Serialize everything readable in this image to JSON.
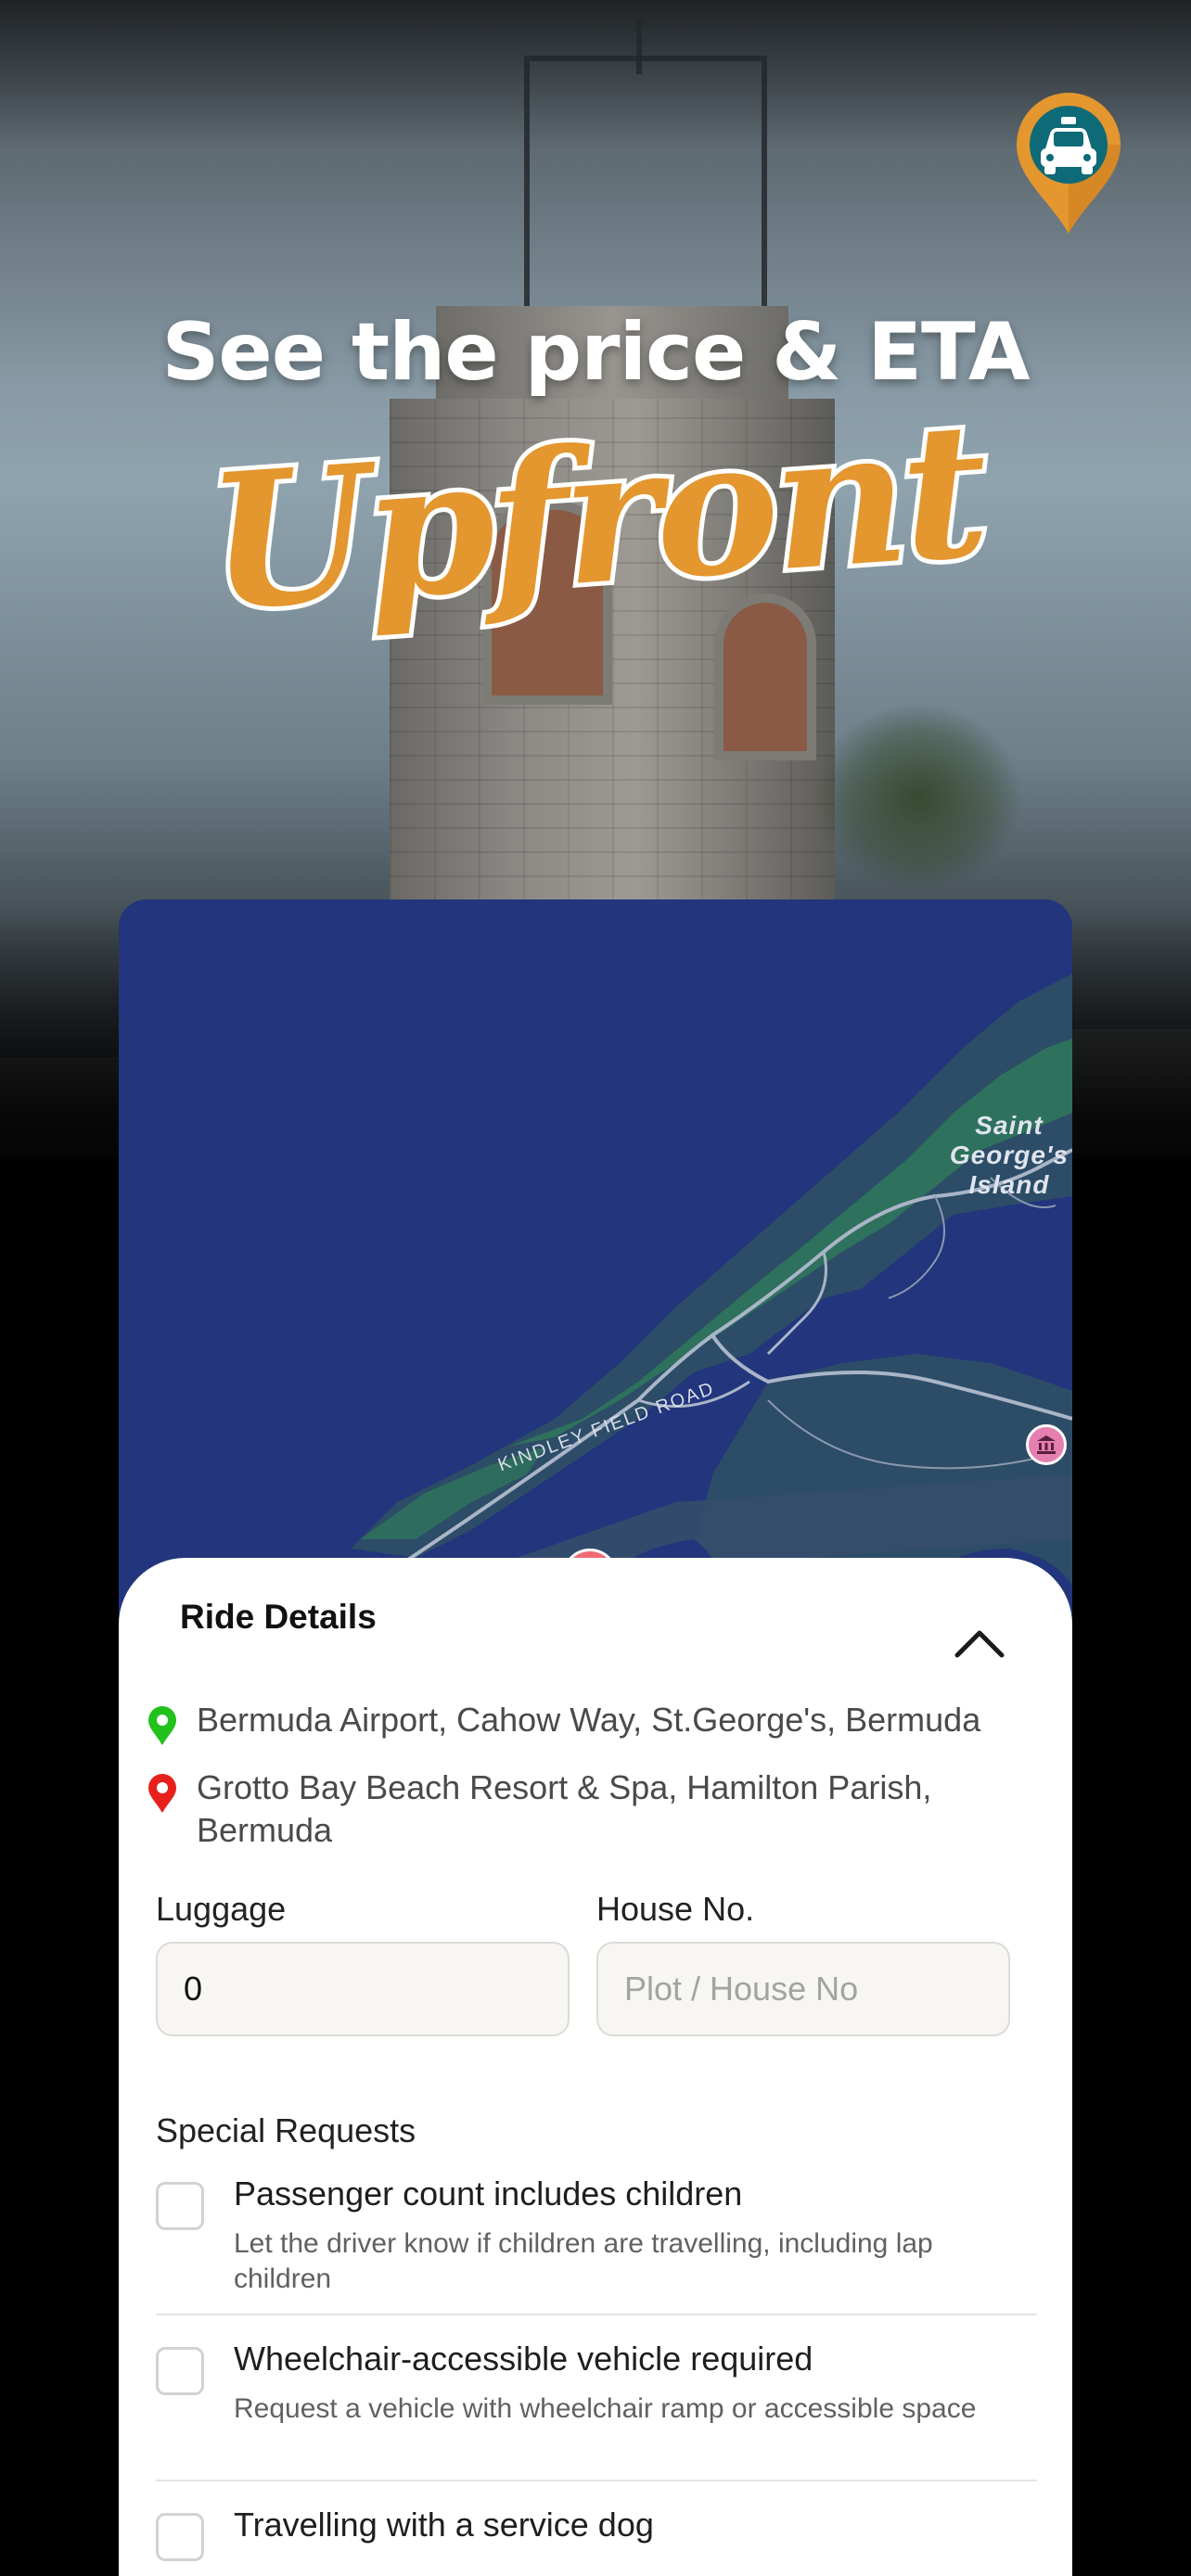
{
  "hero": {
    "headline": "See the price & ETA",
    "script_text": "Upfront",
    "pin_icon": "taxi-icon",
    "colors": {
      "accent_orange": "#e4962f",
      "pin_teal": "#0f6a78"
    }
  },
  "map": {
    "island_label_line1": "Saint",
    "island_label_line2": "George's",
    "island_label_line3": "Island",
    "road_label": "KINDLEY FIELD ROAD",
    "poi_icon": "museum-icon",
    "colors": {
      "water": "#22357d",
      "land": "#2c4c67",
      "vegetation": "#2f7a5a"
    }
  },
  "sheet": {
    "title": "Ride Details",
    "collapse_icon": "chevron-up-icon",
    "pickup": {
      "icon": "pickup-pin-icon",
      "color": "#22c11b",
      "text": "Bermuda Airport, Cahow Way, St.George's, Bermuda"
    },
    "dropoff": {
      "icon": "dropoff-pin-icon",
      "color": "#e8201b",
      "text": "Grotto Bay Beach Resort & Spa, Hamilton Parish, Bermuda"
    },
    "luggage": {
      "label": "Luggage",
      "value": "0"
    },
    "house": {
      "label": "House No.",
      "value": "",
      "placeholder": "Plot / House No"
    },
    "special_requests": {
      "title": "Special Requests",
      "items": [
        {
          "title": "Passenger count includes children",
          "description": "Let the driver know if children are travelling, including lap children",
          "checked": false
        },
        {
          "title": "Wheelchair-accessible vehicle required",
          "description": "Request a vehicle with wheelchair ramp or accessible space",
          "checked": false
        },
        {
          "title": "Travelling with a service dog",
          "description": "",
          "checked": false
        }
      ]
    }
  }
}
